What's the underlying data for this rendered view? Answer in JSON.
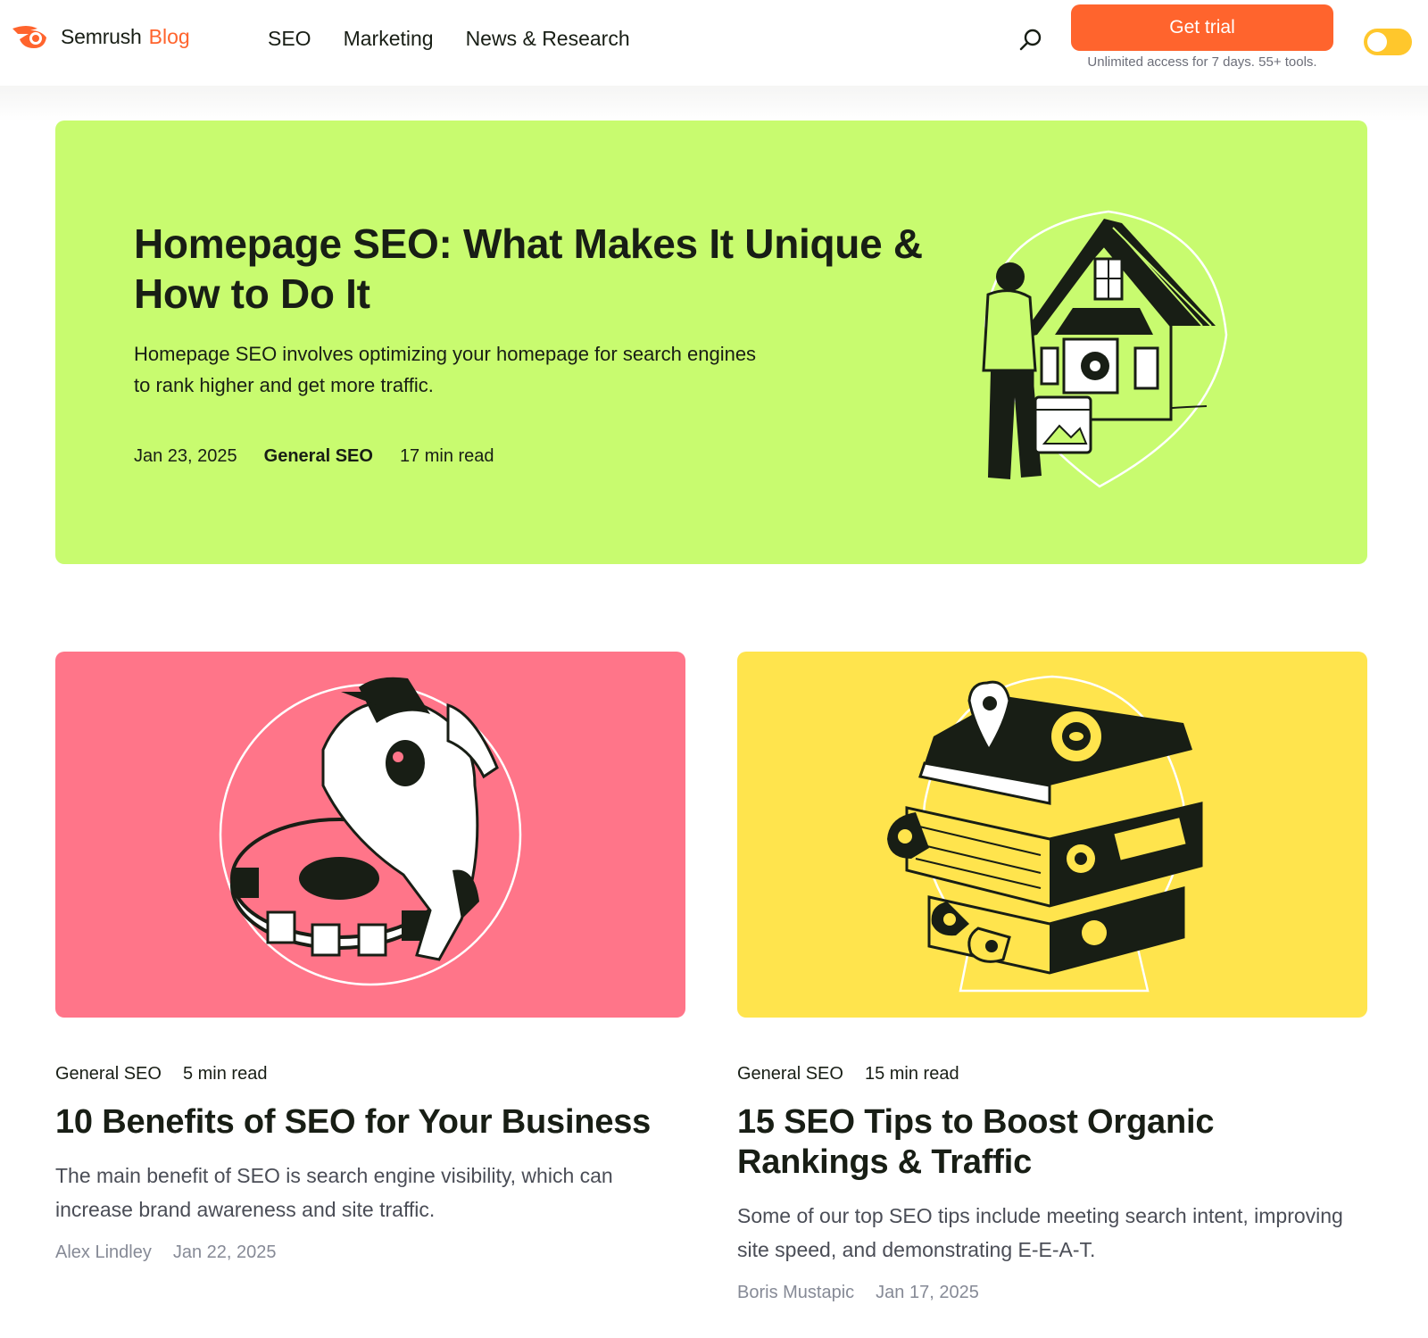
{
  "header": {
    "logo_name": "Semrush",
    "logo_blog": "Blog",
    "nav": [
      "SEO",
      "Marketing",
      "News & Research"
    ],
    "search_icon": "search-icon",
    "trial_button": "Get trial",
    "trial_note": "Unlimited access for 7 days. 55+ tools."
  },
  "hero": {
    "title": "Homepage SEO: What Makes It Unique & How to Do It",
    "description": "Homepage SEO involves optimizing your homepage for search engines to rank higher and get more traffic.",
    "date": "Jan 23, 2025",
    "category": "General SEO",
    "read_time": "17 min read",
    "bg_color": "#c8fb6f"
  },
  "cards": [
    {
      "category": "General SEO",
      "read_time": "5 min read",
      "title": "10 Benefits of SEO for Your Business",
      "description": "The main benefit of SEO is search engine visibility, which can increase brand awareness and site traffic.",
      "author": "Alex Lindley",
      "date": "Jan 22, 2025",
      "bg_color": "#ff7589"
    },
    {
      "category": "General SEO",
      "read_time": "15 min read",
      "title": "15 SEO Tips to Boost Organic Rankings & Traffic",
      "description": "Some of our top SEO tips include meeting search intent, improving site speed, and demonstrating E-E-A-T.",
      "author": "Boris Mustapic",
      "date": "Jan 17, 2025",
      "bg_color": "#ffe44d"
    }
  ],
  "colors": {
    "accent": "#ff642d",
    "toggle": "#ffc72c"
  }
}
